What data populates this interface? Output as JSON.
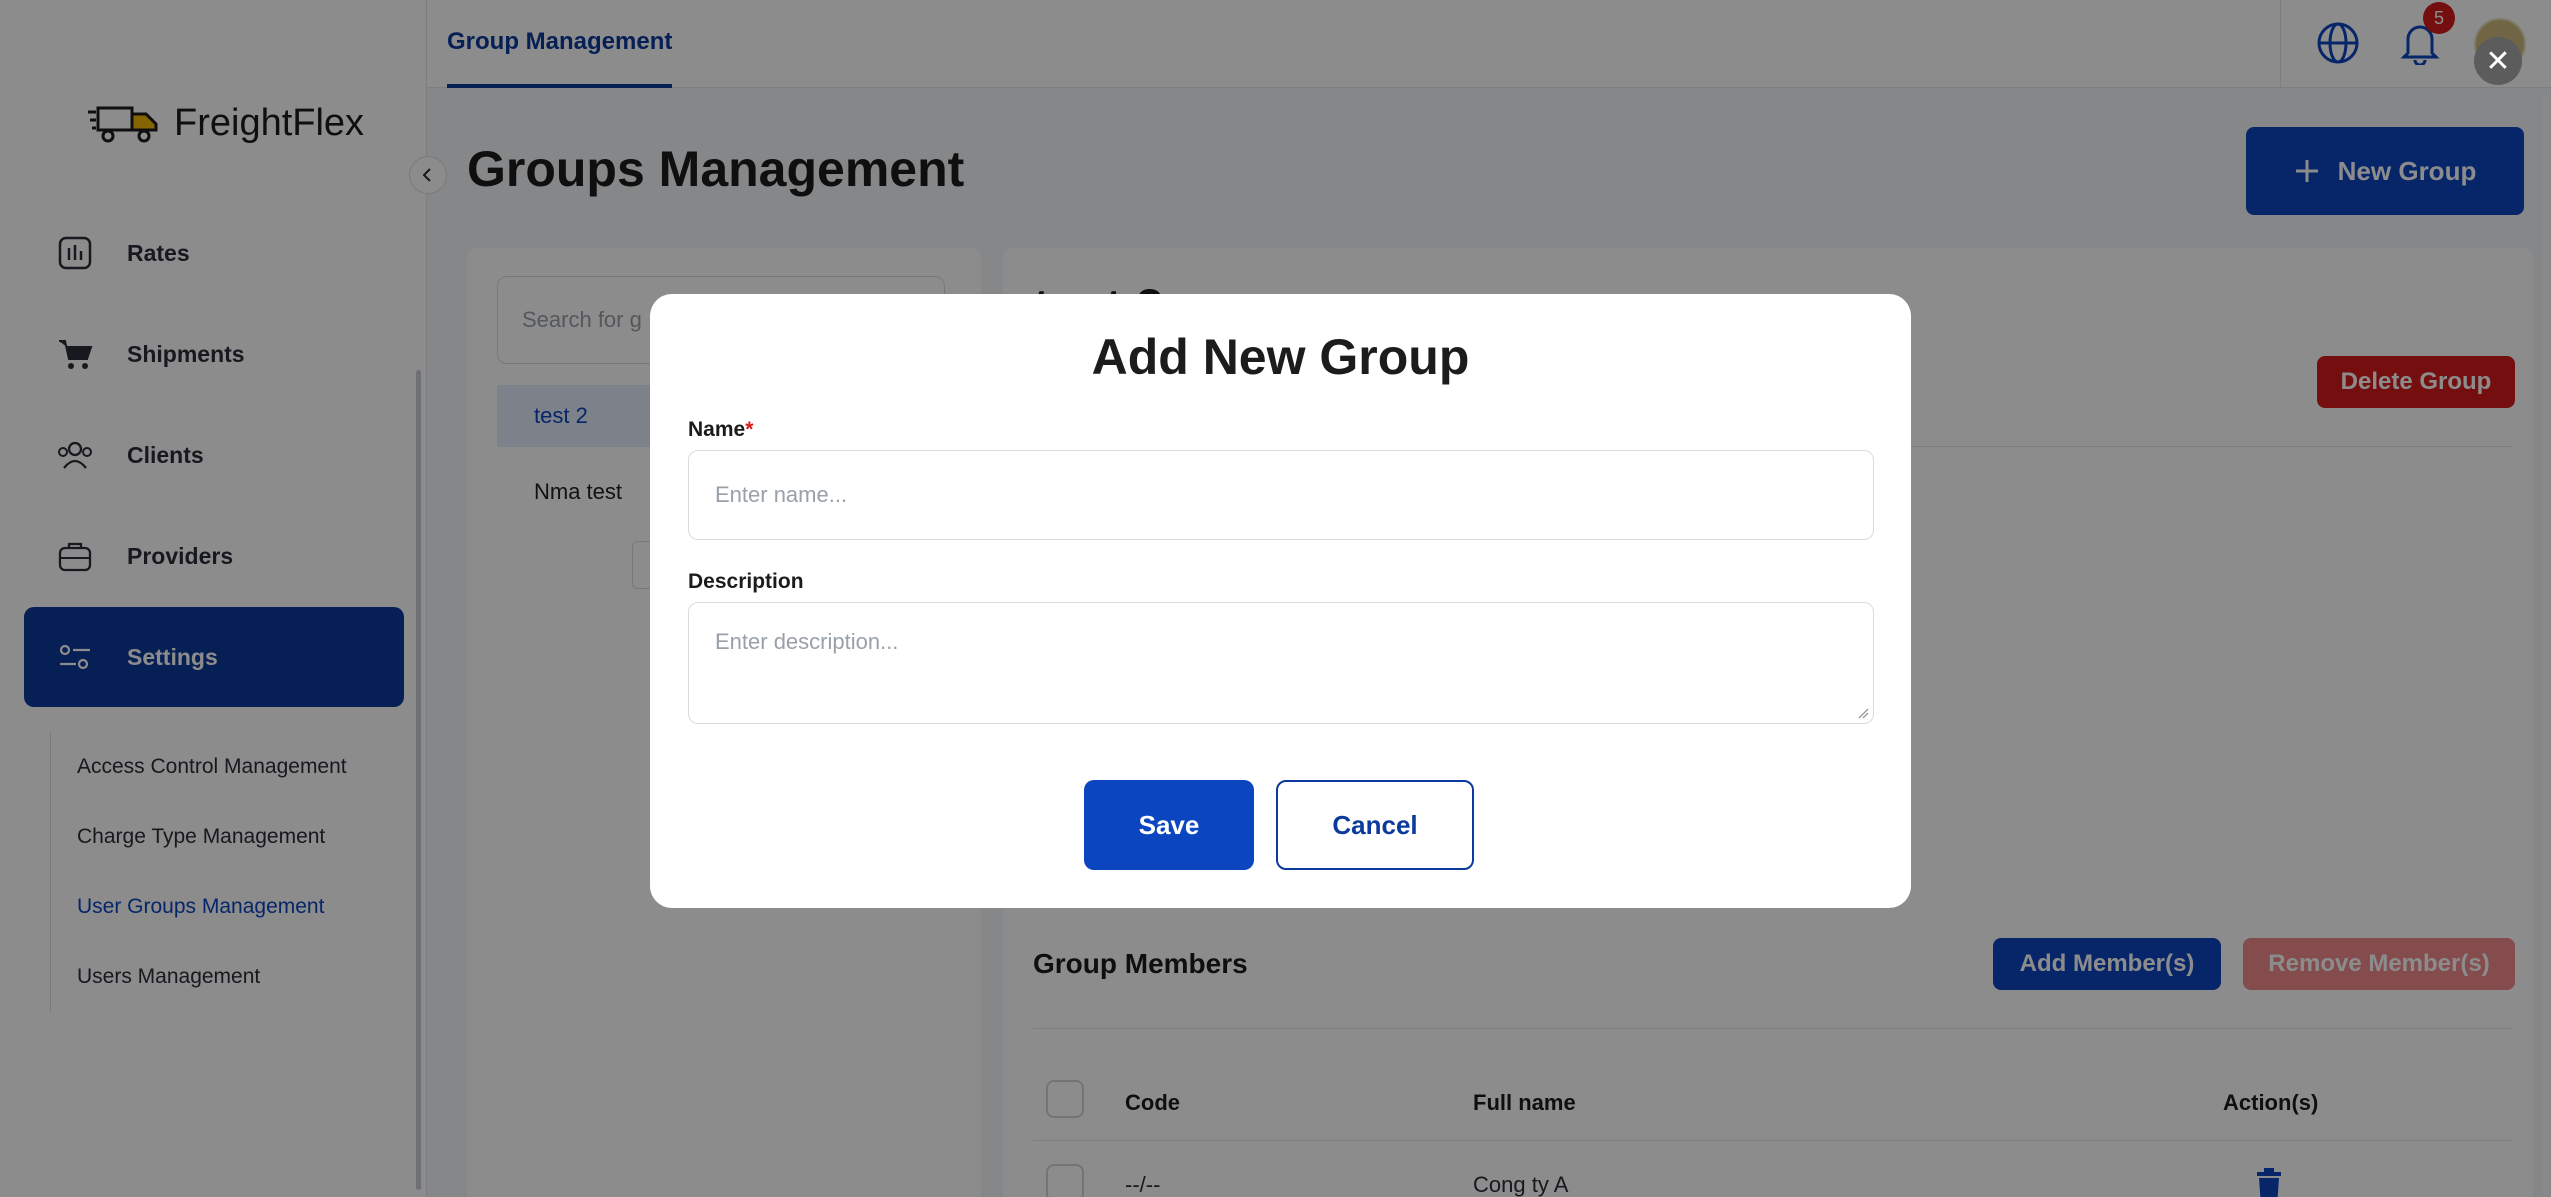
{
  "brand": {
    "name": "FreightFlex"
  },
  "sidebar": {
    "items": [
      {
        "label": "Rates",
        "icon": "chart-bars-icon"
      },
      {
        "label": "Shipments",
        "icon": "cart-icon"
      },
      {
        "label": "Clients",
        "icon": "users-icon"
      },
      {
        "label": "Providers",
        "icon": "briefcase-icon"
      },
      {
        "label": "Settings",
        "icon": "settings-sliders-icon",
        "active": true
      }
    ],
    "subitems": [
      {
        "label": "Access Control Management"
      },
      {
        "label": "Charge Type Management"
      },
      {
        "label": "User Groups Management",
        "active": true
      },
      {
        "label": "Users Management"
      }
    ]
  },
  "topbar": {
    "tab": "Group Management",
    "notifications_count": "5",
    "close_symbol": "✕"
  },
  "main": {
    "title": "Groups Management",
    "new_group_label": "New Group",
    "search_placeholder": "Search for g",
    "groups": [
      {
        "name": "test 2",
        "active": true
      },
      {
        "name": "Nma test"
      }
    ],
    "detail": {
      "title": "test 2",
      "delete_label": "Delete Group",
      "members_title": "Group Members",
      "add_members_label": "Add Member(s)",
      "remove_members_label": "Remove Member(s)",
      "columns": [
        "Code",
        "Full name",
        "Action(s)"
      ],
      "rows": [
        {
          "code": "--/--",
          "full_name": "Cong ty A"
        }
      ]
    }
  },
  "modal": {
    "title": "Add New Group",
    "name_label": "Name",
    "required_mark": "*",
    "name_placeholder": "Enter name...",
    "description_label": "Description",
    "description_placeholder": "Enter description...",
    "save_label": "Save",
    "cancel_label": "Cancel"
  },
  "colors": {
    "primary": "#0b46c0",
    "primary_dark": "#0b3a9c",
    "danger": "#d51c1c",
    "danger_light": "#f08a8a"
  }
}
